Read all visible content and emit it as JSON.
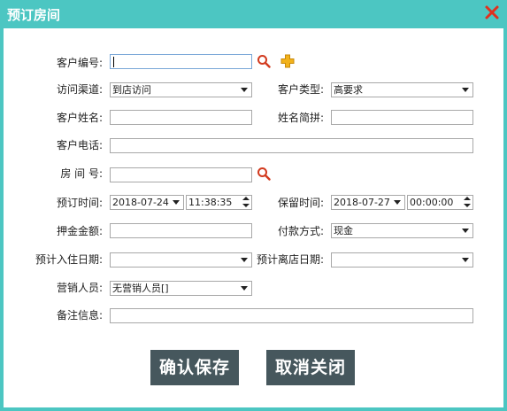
{
  "window": {
    "title": "预订房间"
  },
  "form": {
    "customer_no": {
      "label": "客户编号:",
      "value": ""
    },
    "channel": {
      "label": "访问渠道:",
      "value": "到店访问"
    },
    "customer_type": {
      "label": "客户类型:",
      "value": "高要求"
    },
    "customer_name": {
      "label": "客户姓名:",
      "value": ""
    },
    "name_pinyin": {
      "label": "姓名简拼:",
      "value": ""
    },
    "phone": {
      "label": "客户电话:",
      "value": ""
    },
    "room_no": {
      "label": "房 间 号:",
      "value": ""
    },
    "book_time": {
      "label": "预订时间:",
      "date": "2018-07-24",
      "time": "11:38:35"
    },
    "hold_time": {
      "label": "保留时间:",
      "date": "2018-07-27",
      "time": "00:00:00"
    },
    "deposit": {
      "label": "押金金额:",
      "value": ""
    },
    "payment": {
      "label": "付款方式:",
      "value": "现金"
    },
    "checkin_date": {
      "label": "预计入住日期:",
      "value": ""
    },
    "checkout_date": {
      "label": "预计离店日期:",
      "value": ""
    },
    "sales": {
      "label": "营销人员:",
      "value": "无营销人员[]"
    },
    "remarks": {
      "label": "备注信息:",
      "value": ""
    }
  },
  "buttons": {
    "confirm": "确认保存",
    "cancel": "取消关闭"
  },
  "colors": {
    "titlebar": "#4cc6c2",
    "button": "#46575d",
    "close": "#e0301e",
    "search_icon": "#d23a1e",
    "add_icon": "#f2b21b"
  }
}
